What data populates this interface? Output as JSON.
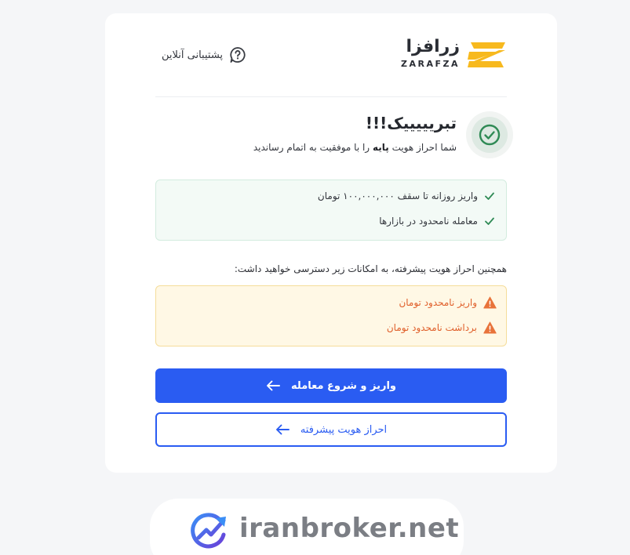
{
  "header": {
    "logo": {
      "fa": "زرافزا",
      "en": "ZARAFZA",
      "icon": "zarafza-logo-mark"
    },
    "support": {
      "label": "پشتیبانی آنلاین",
      "icon": "question-bubble-icon"
    }
  },
  "success": {
    "icon": "check-circle-icon",
    "title": "تبریییییک!!!",
    "subtitle_pre": "شما احراز هویت",
    "subtitle_bold": "پایه",
    "subtitle_post": "را با موفقیت به اتمام رساندید"
  },
  "features": [
    {
      "label": "واریز روزانه تا سقف ۱۰۰,۰۰۰,۰۰۰ تومان",
      "icon": "check-icon"
    },
    {
      "label": "معامله نامحدود در بازارها",
      "icon": "check-icon"
    }
  ],
  "advanced": {
    "heading": "همچنین احراز هویت پیشرفته، به امکانات زیر دسترسی خواهید داشت:",
    "items": [
      {
        "label": "واریز نامحدود تومان",
        "icon": "warning-icon"
      },
      {
        "label": "برداشت نامحدود تومان",
        "icon": "warning-icon"
      }
    ]
  },
  "buttons": {
    "primary": {
      "label": "واریز و شروع معامله",
      "icon": "arrow-left-icon"
    },
    "secondary": {
      "label": "احراز هویت پیشرفته",
      "icon": "arrow-left-icon"
    }
  },
  "watermark": {
    "text": "iranbroker.net",
    "icon": "chart-growth-icon"
  },
  "colors": {
    "brand_yellow": "#f7b91e",
    "primary_blue": "#2a5cf2",
    "success_green": "#2f8a55",
    "warning_orange": "#e0602c",
    "page_bg": "#f5f6f8"
  }
}
